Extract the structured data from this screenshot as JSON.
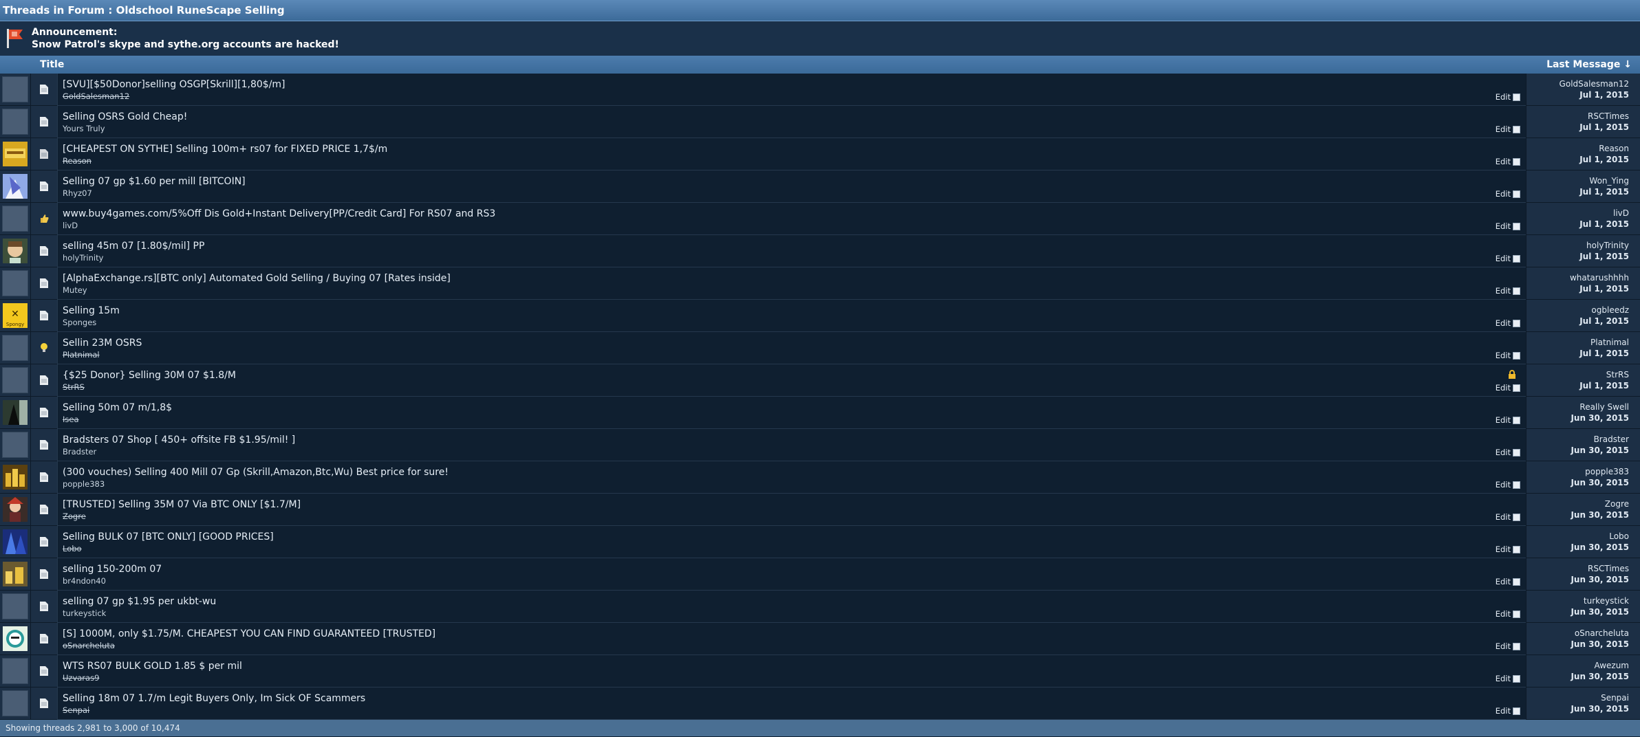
{
  "header": {
    "title": "Threads in Forum : Oldschool RuneScape Selling"
  },
  "announcement": {
    "label": "Announcement:",
    "text": "Snow Patrol's skype and sythe.org accounts are hacked!"
  },
  "columns": {
    "title": "Title",
    "last_message": "Last Message ↓"
  },
  "edit_label": "Edit",
  "threads": [
    {
      "title": "[SVU][$50Donor]selling OSGP[Skrill][1,80$/m]",
      "author": "GoldSalesman12",
      "author_strike": true,
      "avatar": "blank",
      "icon": "page",
      "last_user": "GoldSalesman12",
      "last_date": "Jul 1, 2015"
    },
    {
      "title": "Selling OSRS Gold Cheap!",
      "author": "Yours Truly",
      "author_strike": false,
      "avatar": "blank",
      "icon": "page",
      "last_user": "RSCTimes",
      "last_date": "Jul 1, 2015"
    },
    {
      "title": "[CHEAPEST ON SYTHE] Selling 100m+ rs07 for FIXED PRICE 1,7$/m",
      "author": "Reason",
      "author_strike": true,
      "avatar": "gold",
      "icon": "page-alt",
      "last_user": "Reason",
      "last_date": "Jul 1, 2015"
    },
    {
      "title": "Selling 07 gp $1.60 per mill [BITCOIN]",
      "author": "Rhyz07",
      "author_strike": false,
      "avatar": "anime",
      "icon": "page",
      "last_user": "Won_Ying",
      "last_date": "Jul 1, 2015"
    },
    {
      "title": "www.buy4games.com/5%Off Dis Gold+Instant Delivery[PP/Credit Card] For RS07 and RS3",
      "author": "livD",
      "author_strike": false,
      "avatar": "blank",
      "icon": "thumb",
      "last_user": "livD",
      "last_date": "Jul 1, 2015"
    },
    {
      "title": "selling 45m 07 [1.80$/mil] PP",
      "author": "holyTrinity",
      "author_strike": false,
      "avatar": "face",
      "icon": "page",
      "last_user": "holyTrinity",
      "last_date": "Jul 1, 2015"
    },
    {
      "title": "[AlphaExchange.rs][BTC only] Automated Gold Selling / Buying 07 [Rates inside]",
      "author": "Mutey",
      "author_strike": false,
      "avatar": "blank",
      "icon": "page",
      "last_user": "whatarushhhh",
      "last_date": "Jul 1, 2015"
    },
    {
      "title": "Selling 15m",
      "author": "Sponges",
      "author_strike": false,
      "avatar": "spongy",
      "icon": "page",
      "last_user": "ogbleedz",
      "last_date": "Jul 1, 2015"
    },
    {
      "title": "Sellin 23M OSRS",
      "author": "Platnimal",
      "author_strike": true,
      "avatar": "blank",
      "icon": "bulb",
      "last_user": "Platnimal",
      "last_date": "Jul 1, 2015"
    },
    {
      "title": "{$25 Donor} Selling 30M 07 $1.8/M",
      "author": "StrRS",
      "author_strike": true,
      "avatar": "blank",
      "icon": "page",
      "locked": true,
      "last_user": "StrRS",
      "last_date": "Jul 1, 2015"
    },
    {
      "title": "Selling 50m 07 m/1,8$",
      "author": "Isea",
      "author_strike": true,
      "avatar": "dark",
      "icon": "page",
      "last_user": "Really Swell",
      "last_date": "Jun 30, 2015"
    },
    {
      "title": "Bradsters 07 Shop [ 450+ offsite FB $1.95/mil! ]",
      "author": "Bradster",
      "author_strike": false,
      "avatar": "blank",
      "icon": "page",
      "last_user": "Bradster",
      "last_date": "Jun 30, 2015"
    },
    {
      "title": "(300 vouches) Selling 400 Mill 07 Gp (Skrill,Amazon,Btc,Wu) Best price for sure!",
      "author": "popple383",
      "author_strike": false,
      "avatar": "coins",
      "icon": "page",
      "last_user": "popple383",
      "last_date": "Jun 30, 2015"
    },
    {
      "title": "[TRUSTED] Selling 35M 07 Via BTC ONLY [$1.7/M]",
      "author": "Zogre",
      "author_strike": true,
      "avatar": "char",
      "icon": "page",
      "last_user": "Zogre",
      "last_date": "Jun 30, 2015"
    },
    {
      "title": "Selling BULK 07 [BTC ONLY] [GOOD PRICES]",
      "author": "Lobo",
      "author_strike": true,
      "avatar": "blue",
      "icon": "page",
      "last_user": "Lobo",
      "last_date": "Jun 30, 2015"
    },
    {
      "title": "selling 150-200m 07",
      "author": "br4ndon40",
      "author_strike": false,
      "avatar": "coins2",
      "icon": "page",
      "last_user": "RSCTimes",
      "last_date": "Jun 30, 2015"
    },
    {
      "title": "selling 07 gp $1.95 per ukbt-wu",
      "author": "turkeystick",
      "author_strike": false,
      "avatar": "blank",
      "icon": "page",
      "last_user": "turkeystick",
      "last_date": "Jun 30, 2015"
    },
    {
      "title": "[S] 1000M, only $1.75/M. CHEAPEST YOU CAN FIND GUARANTEED [TRUSTED]",
      "author": "oSnarcheluta",
      "author_strike": true,
      "avatar": "smile",
      "icon": "page",
      "last_user": "oSnarcheluta",
      "last_date": "Jun 30, 2015"
    },
    {
      "title": "WTS RS07 BULK GOLD 1.85 $ per mil",
      "author": "Uzvaras9",
      "author_strike": true,
      "avatar": "blank",
      "icon": "page",
      "last_user": "Awezum",
      "last_date": "Jun 30, 2015"
    },
    {
      "title": "Selling 18m 07 1.7/m Legit Buyers Only, Im Sick OF Scammers",
      "author": "Senpai",
      "author_strike": true,
      "avatar": "blank",
      "icon": "page",
      "last_user": "Senpai",
      "last_date": "Jun 30, 2015"
    }
  ],
  "footer": {
    "text": "Showing threads 2,981 to 3,000 of 10,474"
  },
  "colors": {
    "accent": "#4c7cad",
    "row_bg": "#0f1f30",
    "side_bg": "#1c2f45"
  }
}
